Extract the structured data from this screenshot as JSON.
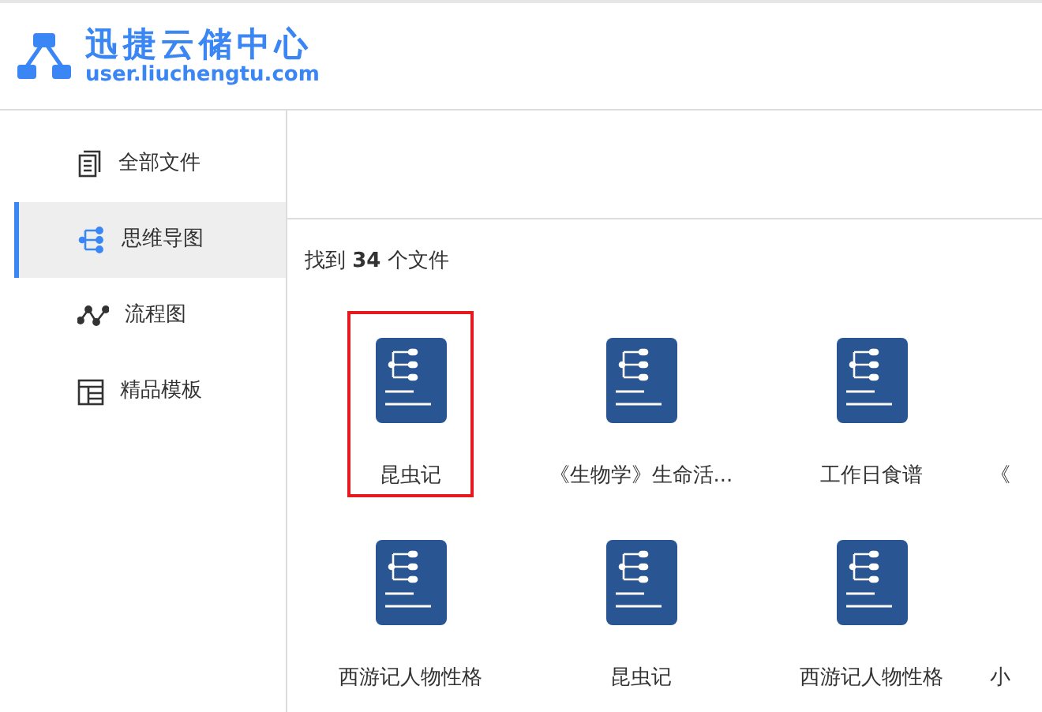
{
  "header": {
    "title": "迅捷云储中心",
    "subtitle": "user.liuchengtu.com"
  },
  "sidebar": {
    "items": [
      {
        "kind": "files",
        "label": "全部文件",
        "selected": false
      },
      {
        "kind": "mindmap",
        "label": "思维导图",
        "selected": true
      },
      {
        "kind": "flowchart",
        "label": "流程图",
        "selected": false
      },
      {
        "kind": "templates",
        "label": "精品模板",
        "selected": false
      }
    ]
  },
  "result_count": "找到 **34** 个文件",
  "files": [
    {
      "label": "昆虫记",
      "selected": true
    },
    {
      "label": "《生物学》生命活...",
      "selected": false
    },
    {
      "label": "工作日食谱",
      "selected": false
    },
    {
      "label": "《",
      "selected": false
    },
    {
      "label": "西游记人物性格",
      "selected": false
    },
    {
      "label": "昆虫记",
      "selected": false
    },
    {
      "label": "西游记人物性格",
      "selected": false
    },
    {
      "label": "小",
      "selected": false
    }
  ]
}
